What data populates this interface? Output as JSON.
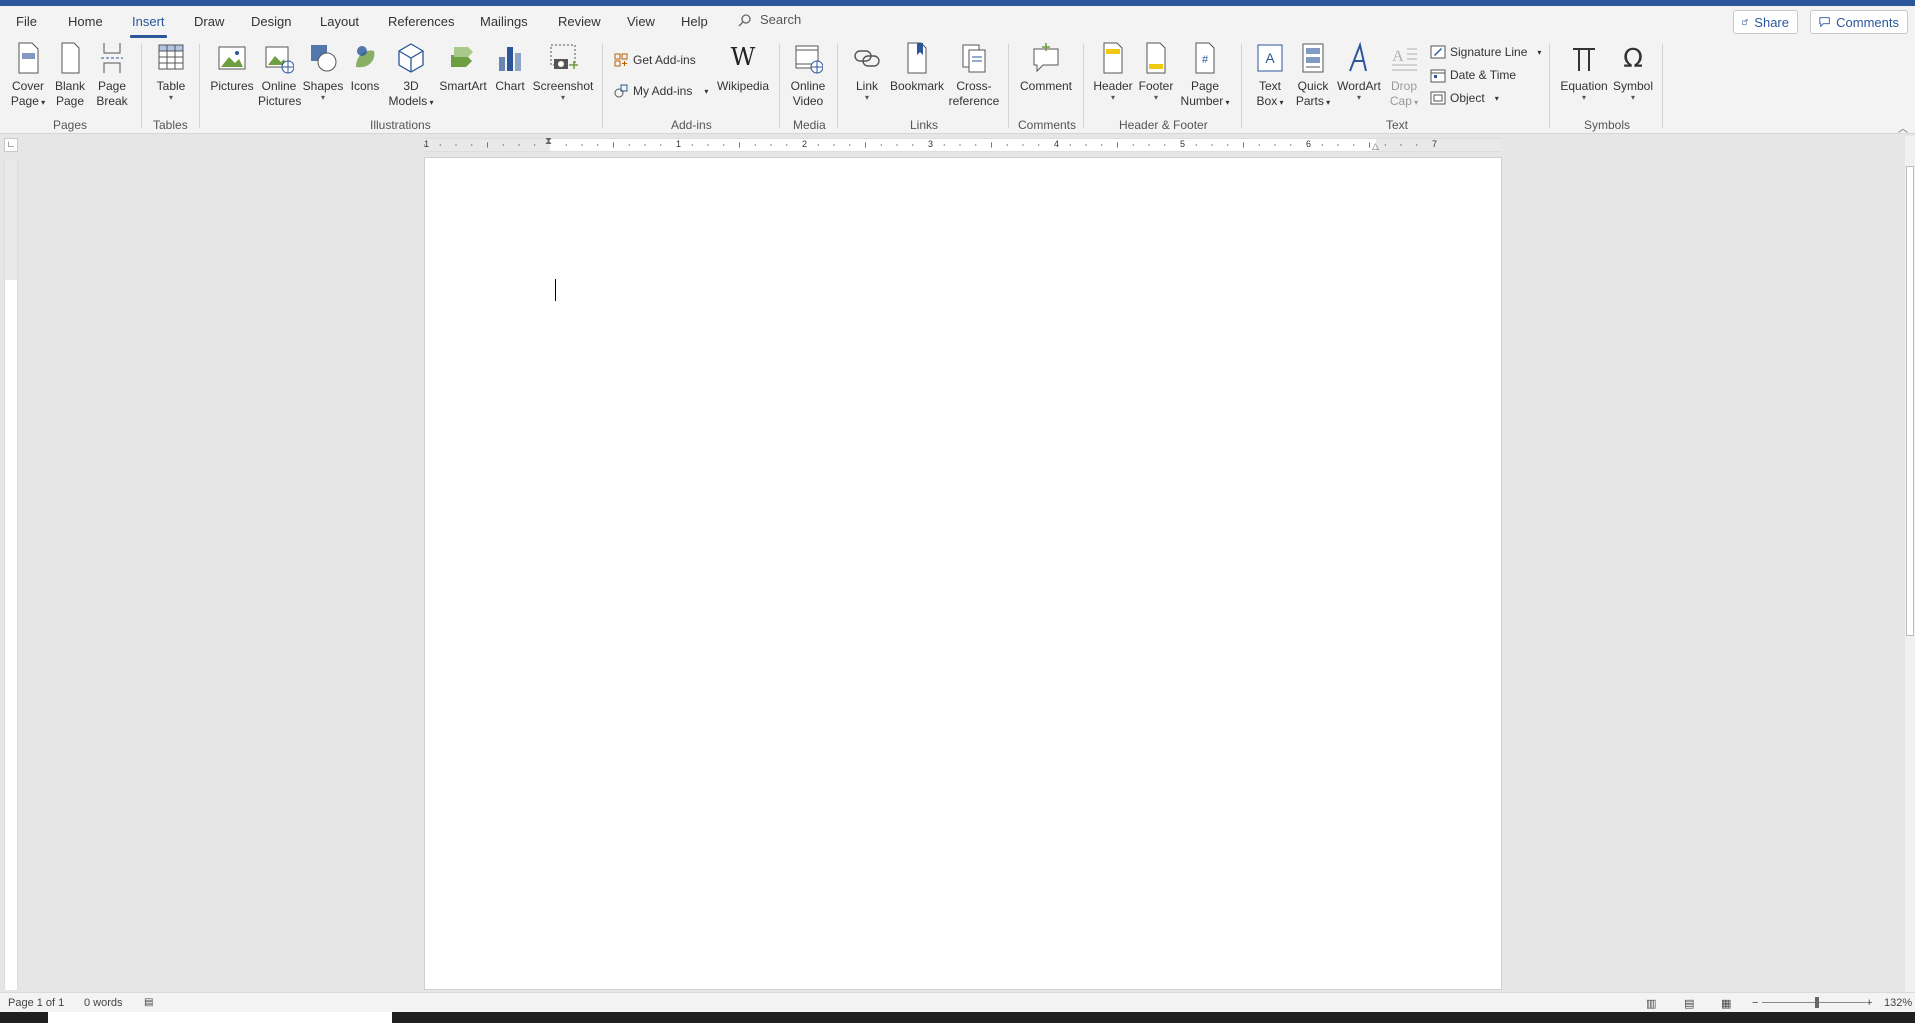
{
  "menu": {
    "tabs": [
      "File",
      "Home",
      "Insert",
      "Draw",
      "Design",
      "Layout",
      "References",
      "Mailings",
      "Review",
      "View",
      "Help"
    ],
    "active_tab": "Insert",
    "search_label": "Search",
    "share_label": "Share",
    "comments_label": "Comments"
  },
  "ribbon": {
    "pages": {
      "cover_l1": "Cover",
      "cover_l2": "Page",
      "blank_l1": "Blank",
      "blank_l2": "Page",
      "break_l1": "Page",
      "break_l2": "Break",
      "group": "Pages"
    },
    "tables": {
      "table": "Table",
      "group": "Tables"
    },
    "illustrations": {
      "pictures": "Pictures",
      "online_l1": "Online",
      "online_l2": "Pictures",
      "shapes": "Shapes",
      "icons": "Icons",
      "models_l1": "3D",
      "models_l2": "Models",
      "smartart": "SmartArt",
      "chart": "Chart",
      "screenshot": "Screenshot",
      "group": "Illustrations"
    },
    "addins": {
      "get": "Get Add-ins",
      "my": "My Add-ins",
      "wikipedia": "Wikipedia",
      "group": "Add-ins"
    },
    "media": {
      "video_l1": "Online",
      "video_l2": "Video",
      "group": "Media"
    },
    "links": {
      "link": "Link",
      "bookmark": "Bookmark",
      "cross_l1": "Cross-",
      "cross_l2": "reference",
      "group": "Links"
    },
    "comments": {
      "comment": "Comment",
      "group": "Comments"
    },
    "header_footer": {
      "header": "Header",
      "footer": "Footer",
      "pagenum_l1": "Page",
      "pagenum_l2": "Number",
      "group": "Header & Footer"
    },
    "text": {
      "textbox_l1": "Text",
      "textbox_l2": "Box",
      "quick_l1": "Quick",
      "quick_l2": "Parts",
      "wordart": "WordArt",
      "drop_l1": "Drop",
      "drop_l2": "Cap",
      "signature": "Signature Line",
      "datetime": "Date & Time",
      "object": "Object",
      "group": "Text"
    },
    "symbols": {
      "equation": "Equation",
      "symbol": "Symbol",
      "group": "Symbols"
    }
  },
  "ruler": {
    "numbers": [
      "1",
      "1",
      "2",
      "3",
      "4",
      "5",
      "6",
      "7"
    ]
  },
  "status": {
    "page": "Page 1 of 1",
    "words": "0 words",
    "zoom": "132%"
  },
  "colors": {
    "accent": "#2b579a",
    "ribbon_bg": "#f3f3f3",
    "workspace_bg": "#e6e6e6"
  }
}
